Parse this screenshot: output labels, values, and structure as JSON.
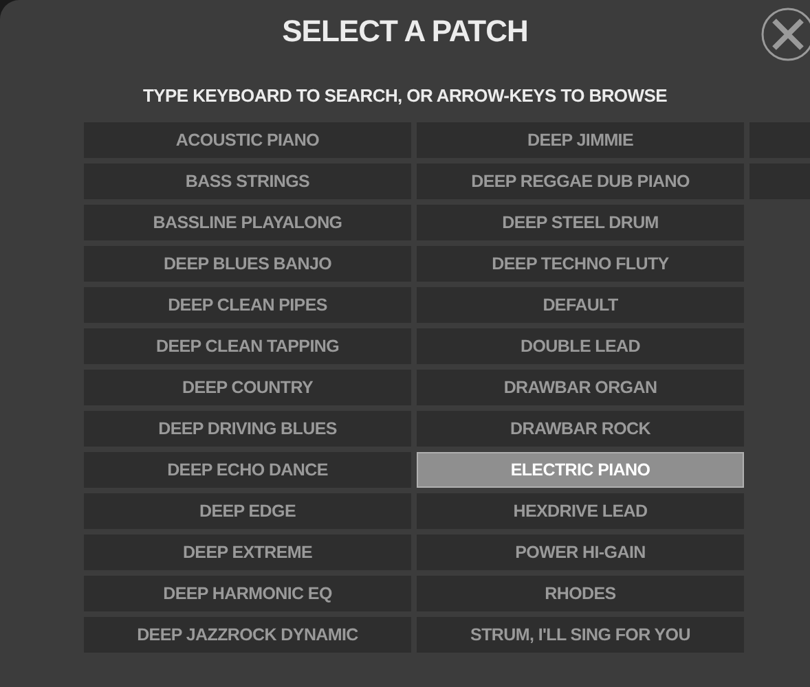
{
  "title": "SELECT A PATCH",
  "hint": "TYPE KEYBOARD TO SEARCH, OR ARROW-KEYS TO BROWSE",
  "columns": [
    [
      {
        "label": "ACOUSTIC PIANO",
        "selected": false
      },
      {
        "label": "BASS STRINGS",
        "selected": false
      },
      {
        "label": "BASSLINE PLAYALONG",
        "selected": false
      },
      {
        "label": "DEEP BLUES BANJO",
        "selected": false
      },
      {
        "label": "DEEP CLEAN PIPES",
        "selected": false
      },
      {
        "label": "DEEP CLEAN TAPPING",
        "selected": false
      },
      {
        "label": "DEEP COUNTRY",
        "selected": false
      },
      {
        "label": "DEEP DRIVING BLUES",
        "selected": false
      },
      {
        "label": "DEEP ECHO DANCE",
        "selected": false
      },
      {
        "label": "DEEP EDGE",
        "selected": false
      },
      {
        "label": "DEEP EXTREME",
        "selected": false
      },
      {
        "label": "DEEP HARMONIC EQ",
        "selected": false
      },
      {
        "label": "DEEP JAZZROCK DYNAMIC",
        "selected": false
      }
    ],
    [
      {
        "label": "DEEP JIMMIE",
        "selected": false
      },
      {
        "label": "DEEP REGGAE DUB PIANO",
        "selected": false
      },
      {
        "label": "DEEP STEEL DRUM",
        "selected": false
      },
      {
        "label": "DEEP TECHNO FLUTY",
        "selected": false
      },
      {
        "label": "DEFAULT",
        "selected": false
      },
      {
        "label": "DOUBLE LEAD",
        "selected": false
      },
      {
        "label": "DRAWBAR ORGAN",
        "selected": false
      },
      {
        "label": "DRAWBAR ROCK",
        "selected": false
      },
      {
        "label": "ELECTRIC PIANO",
        "selected": true
      },
      {
        "label": "HEXDRIVE LEAD",
        "selected": false
      },
      {
        "label": "POWER HI-GAIN",
        "selected": false
      },
      {
        "label": "RHODES",
        "selected": false
      },
      {
        "label": "STRUM, I'LL SING FOR YOU",
        "selected": false
      }
    ],
    [
      {
        "selected": false
      },
      {
        "selected": false
      }
    ]
  ]
}
